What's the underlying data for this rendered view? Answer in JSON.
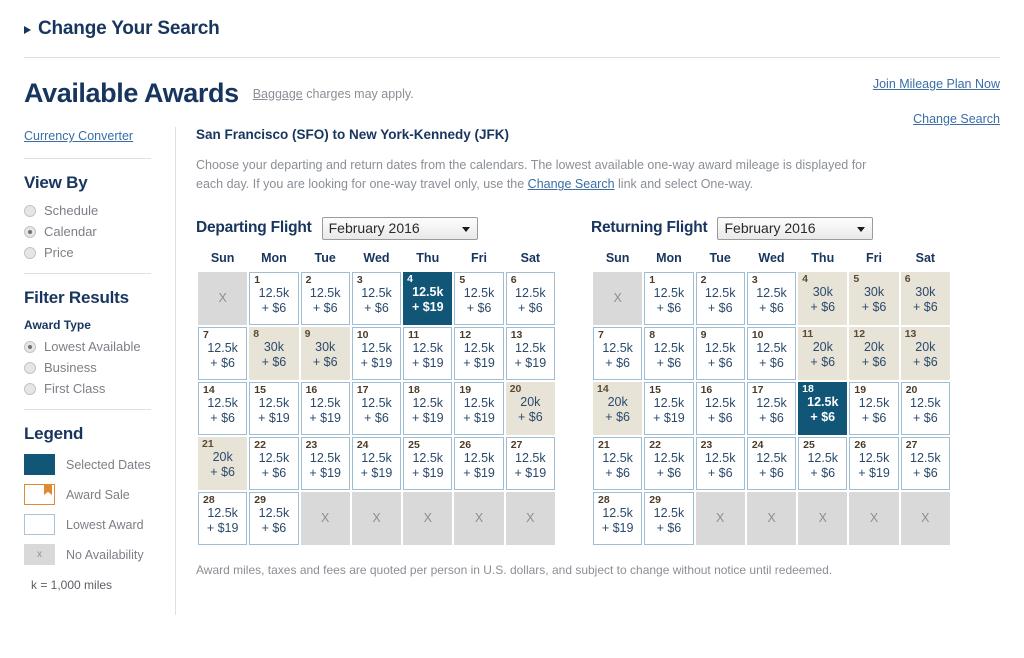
{
  "header": {
    "change_your_search": "Change Your Search",
    "page_title": "Available Awards",
    "baggage_link": "Baggage",
    "baggage_note": " charges may apply.",
    "join_link": "Join Mileage Plan Now",
    "change_search_link": "Change Search"
  },
  "sidebar": {
    "currency_converter": "Currency Converter",
    "view_by": {
      "heading": "View By",
      "options": [
        {
          "label": "Schedule",
          "selected": false
        },
        {
          "label": "Calendar",
          "selected": true
        },
        {
          "label": "Price",
          "selected": false
        }
      ]
    },
    "filter_results": {
      "heading": "Filter Results",
      "subheading": "Award Type",
      "options": [
        {
          "label": "Lowest Available",
          "selected": true
        },
        {
          "label": "Business",
          "selected": false
        },
        {
          "label": "First Class",
          "selected": false
        }
      ]
    },
    "legend": {
      "heading": "Legend",
      "items": [
        {
          "label": "Selected Dates",
          "swatch": "selected",
          "color": "#115577"
        },
        {
          "label": "Award Sale",
          "swatch": "sale",
          "color": "#e08a33"
        },
        {
          "label": "Lowest Award",
          "swatch": "lowest",
          "color": "#a9c4d6"
        },
        {
          "label": "No Availability",
          "swatch": "none",
          "color": "#d9d9d9",
          "glyph": "x"
        }
      ],
      "footnote": "k = 1,000 miles"
    }
  },
  "main": {
    "route": "San Francisco (SFO) to New York-Kennedy (JFK)",
    "intro_part1": "Choose your departing and return dates from the calendars. The lowest available one-way award mileage is displayed for each day. If you are looking for one-way travel only, use the ",
    "intro_link": "Change Search",
    "intro_part2": " link and select One-way.",
    "disclaimer": "Award miles, taxes and fees are quoted per person in U.S. dollars, and subject to change without notice until redeemed.",
    "weekdays": [
      "Sun",
      "Mon",
      "Tue",
      "Wed",
      "Thu",
      "Fri",
      "Sat"
    ]
  },
  "calendars": [
    {
      "id": "departing",
      "title": "Departing Flight",
      "month": "February 2016",
      "weeks": [
        [
          {
            "state": "na",
            "glyph": "X"
          },
          {
            "state": "lowest",
            "day": "1",
            "miles": "12.5k",
            "fee": "+ $6"
          },
          {
            "state": "lowest",
            "day": "2",
            "miles": "12.5k",
            "fee": "+ $6"
          },
          {
            "state": "lowest",
            "day": "3",
            "miles": "12.5k",
            "fee": "+ $6"
          },
          {
            "state": "selected",
            "day": "4",
            "miles": "12.5k",
            "fee": "+ $19"
          },
          {
            "state": "lowest",
            "day": "5",
            "miles": "12.5k",
            "fee": "+ $6"
          },
          {
            "state": "lowest",
            "day": "6",
            "miles": "12.5k",
            "fee": "+ $6"
          }
        ],
        [
          {
            "state": "lowest",
            "day": "7",
            "miles": "12.5k",
            "fee": "+ $6"
          },
          {
            "state": "regular",
            "day": "8",
            "miles": "30k",
            "fee": "+ $6"
          },
          {
            "state": "regular",
            "day": "9",
            "miles": "30k",
            "fee": "+ $6"
          },
          {
            "state": "lowest",
            "day": "10",
            "miles": "12.5k",
            "fee": "+ $19"
          },
          {
            "state": "lowest",
            "day": "11",
            "miles": "12.5k",
            "fee": "+ $19"
          },
          {
            "state": "lowest",
            "day": "12",
            "miles": "12.5k",
            "fee": "+ $19"
          },
          {
            "state": "lowest",
            "day": "13",
            "miles": "12.5k",
            "fee": "+ $19"
          }
        ],
        [
          {
            "state": "lowest",
            "day": "14",
            "miles": "12.5k",
            "fee": "+ $6"
          },
          {
            "state": "lowest",
            "day": "15",
            "miles": "12.5k",
            "fee": "+ $19"
          },
          {
            "state": "lowest",
            "day": "16",
            "miles": "12.5k",
            "fee": "+ $19"
          },
          {
            "state": "lowest",
            "day": "17",
            "miles": "12.5k",
            "fee": "+ $6"
          },
          {
            "state": "lowest",
            "day": "18",
            "miles": "12.5k",
            "fee": "+ $19"
          },
          {
            "state": "lowest",
            "day": "19",
            "miles": "12.5k",
            "fee": "+ $19"
          },
          {
            "state": "regular",
            "day": "20",
            "miles": "20k",
            "fee": "+ $6"
          }
        ],
        [
          {
            "state": "regular",
            "day": "21",
            "miles": "20k",
            "fee": "+ $6"
          },
          {
            "state": "lowest",
            "day": "22",
            "miles": "12.5k",
            "fee": "+ $6"
          },
          {
            "state": "lowest",
            "day": "23",
            "miles": "12.5k",
            "fee": "+ $19"
          },
          {
            "state": "lowest",
            "day": "24",
            "miles": "12.5k",
            "fee": "+ $19"
          },
          {
            "state": "lowest",
            "day": "25",
            "miles": "12.5k",
            "fee": "+ $19"
          },
          {
            "state": "lowest",
            "day": "26",
            "miles": "12.5k",
            "fee": "+ $19"
          },
          {
            "state": "lowest",
            "day": "27",
            "miles": "12.5k",
            "fee": "+ $19"
          }
        ],
        [
          {
            "state": "lowest",
            "day": "28",
            "miles": "12.5k",
            "fee": "+ $19"
          },
          {
            "state": "lowest",
            "day": "29",
            "miles": "12.5k",
            "fee": "+ $6"
          },
          {
            "state": "na",
            "glyph": "X"
          },
          {
            "state": "na",
            "glyph": "X"
          },
          {
            "state": "na",
            "glyph": "X"
          },
          {
            "state": "na",
            "glyph": "X"
          },
          {
            "state": "na",
            "glyph": "X"
          }
        ]
      ]
    },
    {
      "id": "returning",
      "title": "Returning Flight",
      "month": "February 2016",
      "weeks": [
        [
          {
            "state": "na",
            "glyph": "X"
          },
          {
            "state": "lowest",
            "day": "1",
            "miles": "12.5k",
            "fee": "+ $6"
          },
          {
            "state": "lowest",
            "day": "2",
            "miles": "12.5k",
            "fee": "+ $6"
          },
          {
            "state": "lowest",
            "day": "3",
            "miles": "12.5k",
            "fee": "+ $6"
          },
          {
            "state": "regular",
            "day": "4",
            "miles": "30k",
            "fee": "+ $6"
          },
          {
            "state": "regular",
            "day": "5",
            "miles": "30k",
            "fee": "+ $6"
          },
          {
            "state": "regular",
            "day": "6",
            "miles": "30k",
            "fee": "+ $6"
          }
        ],
        [
          {
            "state": "lowest",
            "day": "7",
            "miles": "12.5k",
            "fee": "+ $6"
          },
          {
            "state": "lowest",
            "day": "8",
            "miles": "12.5k",
            "fee": "+ $6"
          },
          {
            "state": "lowest",
            "day": "9",
            "miles": "12.5k",
            "fee": "+ $6"
          },
          {
            "state": "lowest",
            "day": "10",
            "miles": "12.5k",
            "fee": "+ $6"
          },
          {
            "state": "regular",
            "day": "11",
            "miles": "20k",
            "fee": "+ $6"
          },
          {
            "state": "regular",
            "day": "12",
            "miles": "20k",
            "fee": "+ $6"
          },
          {
            "state": "regular",
            "day": "13",
            "miles": "20k",
            "fee": "+ $6"
          }
        ],
        [
          {
            "state": "regular",
            "day": "14",
            "miles": "20k",
            "fee": "+ $6"
          },
          {
            "state": "lowest",
            "day": "15",
            "miles": "12.5k",
            "fee": "+ $19"
          },
          {
            "state": "lowest",
            "day": "16",
            "miles": "12.5k",
            "fee": "+ $6"
          },
          {
            "state": "lowest",
            "day": "17",
            "miles": "12.5k",
            "fee": "+ $6"
          },
          {
            "state": "selected",
            "day": "18",
            "miles": "12.5k",
            "fee": "+ $6"
          },
          {
            "state": "lowest",
            "day": "19",
            "miles": "12.5k",
            "fee": "+ $6"
          },
          {
            "state": "lowest",
            "day": "20",
            "miles": "12.5k",
            "fee": "+ $6"
          }
        ],
        [
          {
            "state": "lowest",
            "day": "21",
            "miles": "12.5k",
            "fee": "+ $6"
          },
          {
            "state": "lowest",
            "day": "22",
            "miles": "12.5k",
            "fee": "+ $6"
          },
          {
            "state": "lowest",
            "day": "23",
            "miles": "12.5k",
            "fee": "+ $6"
          },
          {
            "state": "lowest",
            "day": "24",
            "miles": "12.5k",
            "fee": "+ $6"
          },
          {
            "state": "lowest",
            "day": "25",
            "miles": "12.5k",
            "fee": "+ $6"
          },
          {
            "state": "lowest",
            "day": "26",
            "miles": "12.5k",
            "fee": "+ $19"
          },
          {
            "state": "lowest",
            "day": "27",
            "miles": "12.5k",
            "fee": "+ $6"
          }
        ],
        [
          {
            "state": "lowest",
            "day": "28",
            "miles": "12.5k",
            "fee": "+ $19"
          },
          {
            "state": "lowest",
            "day": "29",
            "miles": "12.5k",
            "fee": "+ $6"
          },
          {
            "state": "na",
            "glyph": "X"
          },
          {
            "state": "na",
            "glyph": "X"
          },
          {
            "state": "na",
            "glyph": "X"
          },
          {
            "state": "na",
            "glyph": "X"
          },
          {
            "state": "na",
            "glyph": "X"
          }
        ]
      ]
    }
  ]
}
